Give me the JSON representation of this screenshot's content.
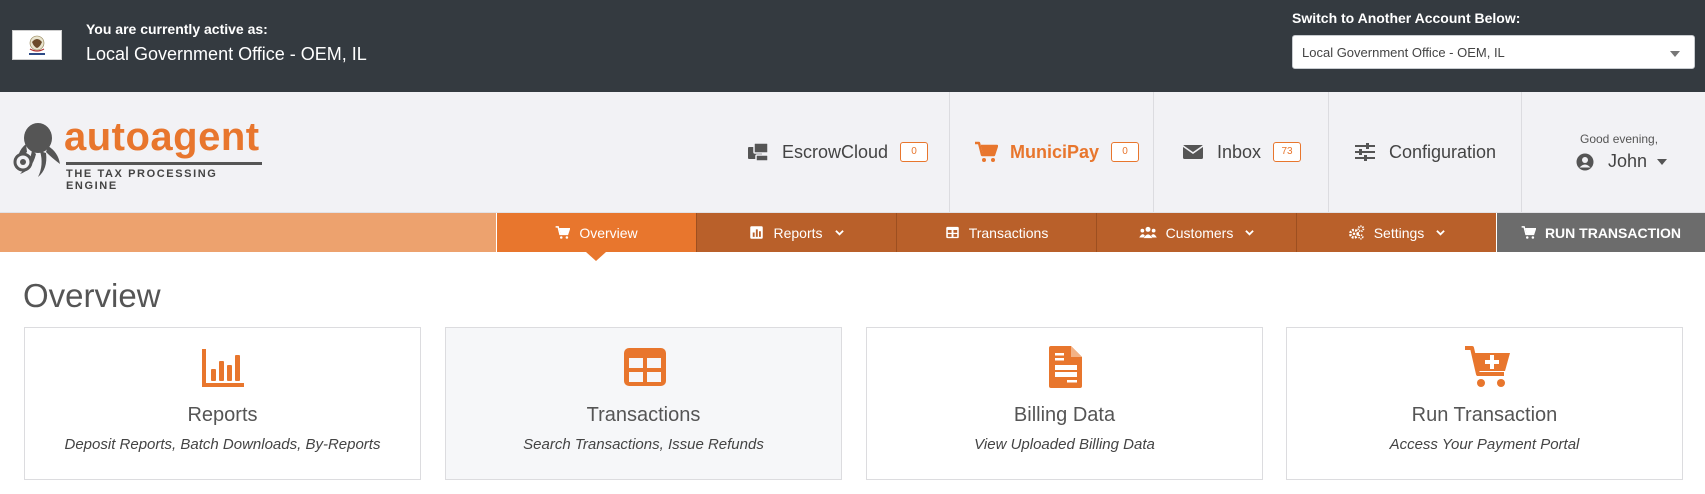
{
  "account": {
    "active_label": "You are currently active as:",
    "active_value": "Local Government Office - OEM, IL",
    "switch_label": "Switch to Another Account Below:",
    "switch_selected": "Local Government Office - OEM, IL"
  },
  "brand": {
    "name": "autoagent",
    "tagline": "THE TAX PROCESSING ENGINE",
    "accent_color": "#e8762d"
  },
  "header_nav": [
    {
      "label": "EscrowCloud",
      "badge": "0",
      "icon": "escrow-icon"
    },
    {
      "label": "MuniciPay",
      "badge": "0",
      "icon": "cart-icon"
    },
    {
      "label": "Inbox",
      "badge": "73",
      "icon": "envelope-icon"
    },
    {
      "label": "Configuration",
      "icon": "sliders-icon"
    }
  ],
  "user": {
    "greeting": "Good evening,",
    "name": "John"
  },
  "main_nav": [
    {
      "label": "Overview",
      "icon": "cart-icon",
      "active": true
    },
    {
      "label": "Reports",
      "icon": "bar-chart-icon",
      "dropdown": true
    },
    {
      "label": "Transactions",
      "icon": "table-icon"
    },
    {
      "label": "Customers",
      "icon": "users-icon",
      "dropdown": true
    },
    {
      "label": "Settings",
      "icon": "cogs-icon",
      "dropdown": true
    },
    {
      "label": "RUN TRANSACTION",
      "icon": "cart-icon"
    }
  ],
  "page": {
    "title": "Overview"
  },
  "cards": [
    {
      "title": "Reports",
      "subtitle": "Deposit Reports, Batch Downloads, By-Reports",
      "icon": "bar-chart-icon"
    },
    {
      "title": "Transactions",
      "subtitle": "Search Transactions, Issue Refunds",
      "icon": "table-icon"
    },
    {
      "title": "Billing Data",
      "subtitle": "View Uploaded Billing Data",
      "icon": "file-icon"
    },
    {
      "title": "Run Transaction",
      "subtitle": "Access Your Payment Portal",
      "icon": "cart-plus-icon"
    }
  ]
}
